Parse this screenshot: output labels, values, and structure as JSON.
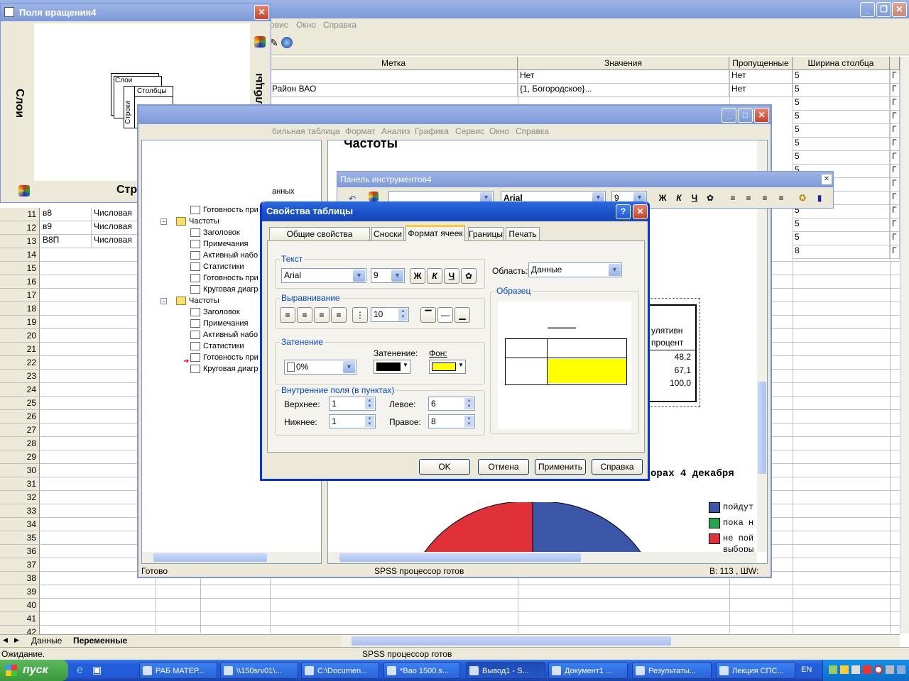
{
  "main_window": {
    "menu": [
      "рвис",
      "Окно",
      "Справка"
    ],
    "columns": [
      "Метка",
      "Значения",
      "Пропущенные",
      "Ширина столбца"
    ],
    "top_rows": [
      {
        "label": "",
        "values": "Нет",
        "missing": "Нет",
        "width": "5"
      },
      {
        "label": "Район ВАО",
        "values": "{1, Богородское}...",
        "missing": "Нет",
        "width": "5"
      }
    ],
    "width_column_rest": [
      "5",
      "5",
      "5",
      "5",
      "5",
      "5",
      "5",
      "5",
      "5",
      "5",
      "5",
      "8"
    ],
    "rows": [
      {
        "num": "11",
        "name": "в8",
        "type": "Числовая"
      },
      {
        "num": "12",
        "name": "в9",
        "type": "Числовая"
      },
      {
        "num": "13",
        "name": "В8П",
        "type": "Числовая"
      }
    ],
    "empty_rows": [
      "14",
      "15",
      "16",
      "17",
      "18",
      "19",
      "20",
      "21",
      "22",
      "23",
      "24",
      "25",
      "26",
      "27",
      "28",
      "29",
      "30",
      "31",
      "32",
      "33",
      "34",
      "35",
      "36",
      "37",
      "38",
      "39",
      "40",
      "41",
      "42"
    ],
    "sheet_tabs": {
      "data": "Данные",
      "variables": "Переменные"
    },
    "status_left": "Ожидание.",
    "status_center": "SPSS процессор готов"
  },
  "pivot_window": {
    "title": "Поля вращения4",
    "layers_label": "Слои",
    "columns_label": "Столбцы",
    "rows_label": "Строки",
    "diagram_layers": "Слои",
    "diagram_columns": "Столбцы",
    "diagram_rows": "Строки"
  },
  "viewer_window": {
    "menu": [
      "бильная таблица",
      "Формат",
      "Анализ",
      "Графика",
      "Сервис",
      "Окно",
      "Справка"
    ],
    "heading": "Частоты",
    "tree_fragment": "анных",
    "tree": [
      {
        "label": "Готовность при",
        "indent": 2,
        "kind": "chart"
      },
      {
        "label": "Частоты",
        "indent": 1,
        "kind": "book"
      },
      {
        "label": "Заголовок",
        "indent": 2,
        "kind": "doc"
      },
      {
        "label": "Примечания",
        "indent": 2,
        "kind": "doc"
      },
      {
        "label": "Активный набо",
        "indent": 2,
        "kind": "doc"
      },
      {
        "label": "Статистики",
        "indent": 2,
        "kind": "doc"
      },
      {
        "label": "Готовность при",
        "indent": 2,
        "kind": "doc"
      },
      {
        "label": "Круговая диагр",
        "indent": 2,
        "kind": "chart"
      },
      {
        "label": "Частоты",
        "indent": 1,
        "kind": "book"
      },
      {
        "label": "Заголовок",
        "indent": 2,
        "kind": "doc"
      },
      {
        "label": "Примечания",
        "indent": 2,
        "kind": "doc"
      },
      {
        "label": "Активный набо",
        "indent": 2,
        "kind": "doc"
      },
      {
        "label": "Статистики",
        "indent": 2,
        "kind": "doc"
      },
      {
        "label": "Готовность при",
        "indent": 2,
        "kind": "doc"
      },
      {
        "label": "Круговая диагр",
        "indent": 2,
        "kind": "chart"
      }
    ],
    "table_header_1": "улятивн",
    "table_header_2": "процент",
    "table_values": [
      "48,2",
      "67,1",
      "100,0"
    ],
    "chart_title_fragment": "орах 4 декабря",
    "legend": [
      {
        "label": "пойдут",
        "color": "#3b56a6"
      },
      {
        "label": "пока н",
        "color": "#22a84a"
      },
      {
        "label": "не пой",
        "color": "#e03038"
      }
    ],
    "legend_extra": "выборы",
    "status_left": "Готово",
    "status_center": "SPSS процессор готов",
    "status_right": "В: 113 , ШW:"
  },
  "toolbar_window": {
    "title": "Панель инструментов4",
    "font": "Arial",
    "font_size": "9",
    "bold": "Ж",
    "italic": "К",
    "underline": "Ч"
  },
  "dialog": {
    "title": "Свойства таблицы",
    "tabs": [
      "Общие свойства таблицы",
      "Сноски",
      "Формат ячеек",
      "Границы",
      "Печать"
    ],
    "text_group": "Текст",
    "font": "Arial",
    "font_size": "9",
    "bold": "Ж",
    "italic": "К",
    "underline": "Ч",
    "area_label": "Область:",
    "area_value": "Данные",
    "align_group": "Выравнивание",
    "indent_value": "10",
    "shading_group": "Затенение",
    "shading_value": "0%",
    "shading_label": "Затенение:",
    "background_label": "Фон:",
    "shading_color": "#000000",
    "background_color": "#ffff00",
    "sample_group": "Образец",
    "margins_group": "Внутренние поля (в пунктах)",
    "top_label": "Верхнее:",
    "top_value": "1",
    "bottom_label": "Нижнее:",
    "bottom_value": "1",
    "left_label": "Левое:",
    "left_value": "6",
    "right_label": "Правое:",
    "right_value": "8",
    "ok": "OK",
    "cancel": "Отмена",
    "apply": "Применить",
    "help": "Справка"
  },
  "taskbar": {
    "start": "пуск",
    "items": [
      "РАБ МАТЕР...",
      "\\\\150srv01\\...",
      "C:\\Documen...",
      "*Bao 1500.s...",
      "Вывод1 - S...",
      "Документ1 ...",
      "Результаты...",
      "Лекция СПС..."
    ],
    "lang": "EN"
  }
}
